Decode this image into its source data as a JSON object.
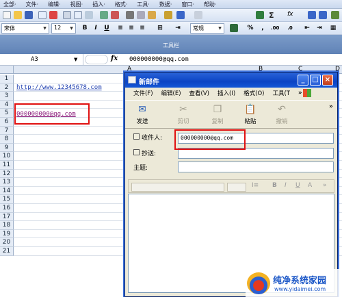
{
  "excel": {
    "menu": [
      "全部·",
      "文件·",
      "编辑·",
      "视图·",
      "插入·",
      "格式·",
      "工具·",
      "数据·",
      "窗口·",
      "帮助·"
    ],
    "font_name": "宋体",
    "font_size": "12",
    "number_format": "常规",
    "toolbar_strip_label": "工具栏",
    "name_box": "A3",
    "fx": "fx",
    "formula_value": "000000000@qq.com",
    "col_headers": {
      "a": "A",
      "b": "B",
      "c": "C",
      "d": "D"
    },
    "rows": [
      "1",
      "2",
      "3",
      "4",
      "5",
      "6",
      "7",
      "8",
      "9",
      "10",
      "11",
      "12",
      "13",
      "14",
      "15",
      "16",
      "17",
      "18",
      "19",
      "20",
      "21"
    ],
    "cell_a1": "http://www.12345678.com",
    "cell_a3": "000000000@qq.com"
  },
  "mail_window": {
    "title": "新邮件",
    "menu": [
      "文件(F)",
      "编辑(E)",
      "查看(V)",
      "插入(I)",
      "格式(O)",
      "工具(T"
    ],
    "menu_more": "»",
    "toolbar": {
      "send": "发送",
      "cut": "剪切",
      "copy": "复制",
      "paste": "粘贴",
      "undo": "撤销",
      "more": "»"
    },
    "to_label": "收件人:",
    "to_value": "000000000@qq.com",
    "cc_label": "抄送:",
    "subject_label": "主题:",
    "format_buttons": {
      "b": "B",
      "i": "I",
      "u": "U",
      "a": "A"
    }
  },
  "watermark": {
    "line1": "纯净系统家园",
    "line2": "www.yidaimei.com"
  },
  "colors": {
    "titlebar": "#0b44c4",
    "highlight_box": "#e01010",
    "link": "#1f3fb0"
  }
}
